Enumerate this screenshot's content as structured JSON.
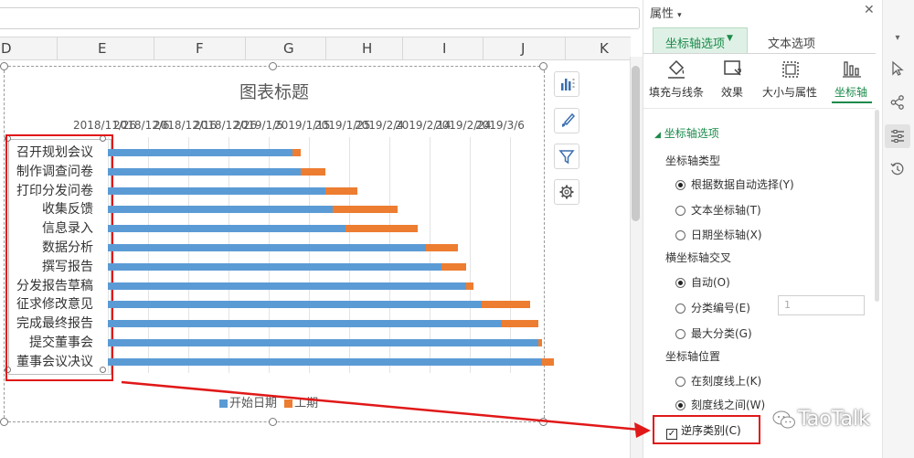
{
  "spreadsheet": {
    "columns": [
      "D",
      "E",
      "F",
      "G",
      "H",
      "I",
      "J",
      "K"
    ]
  },
  "chart": {
    "title": "图表标题",
    "legend": [
      "开始日期",
      "工期"
    ]
  },
  "chart_data": {
    "type": "bar",
    "orientation": "horizontal-stacked",
    "title": "图表标题",
    "x_tick_labels": [
      "2018/11/26",
      "2018/12/6",
      "2018/12/16",
      "2018/12/26",
      "2019/1/5",
      "2019/1/15",
      "2019/1/25",
      "2019/2/4",
      "2019/2/14",
      "2019/2/24",
      "2019/3/6"
    ],
    "categories": [
      "召开规划会议",
      "制作调查问卷",
      "打印分发问卷",
      "收集反馈",
      "信息录入",
      "数据分析",
      "撰写报告",
      "分发报告草稿",
      "征求修改意见",
      "完成最终报告",
      "提交董事会",
      "董事会议决议"
    ],
    "x_axis_start": "2018/11/26",
    "x_axis_end": "2019/3/6",
    "series": [
      {
        "name": "开始日期",
        "color": "#5b9bd5",
        "values": [
          "2019/1/11",
          "2019/1/13",
          "2019/1/19",
          "2019/1/21",
          "2019/1/24",
          "2019/2/13",
          "2019/2/17",
          "2019/2/23",
          "2019/2/27",
          "2019/3/4",
          "2019/3/13",
          "2019/3/14"
        ]
      },
      {
        "name": "工期",
        "color": "#ed7d31",
        "unit": "days",
        "values": [
          2,
          6,
          8,
          16,
          18,
          8,
          6,
          2,
          12,
          9,
          1,
          3
        ]
      }
    ],
    "legend_position": "bottom",
    "grid": true
  },
  "panel": {
    "header": "属性",
    "tabs": [
      "坐标轴选项",
      "文本选项"
    ],
    "subtabs": [
      {
        "label": "填充与线条",
        "icon": "fill-bucket-icon"
      },
      {
        "label": "效果",
        "icon": "effects-icon"
      },
      {
        "label": "大小与属性",
        "icon": "size-properties-icon"
      },
      {
        "label": "坐标轴",
        "icon": "axis-bars-icon"
      }
    ],
    "section_title": "坐标轴选项",
    "axis_type": {
      "label": "坐标轴类型",
      "options": [
        "根据数据自动选择(Y)",
        "文本坐标轴(T)",
        "日期坐标轴(X)"
      ],
      "selected": 0
    },
    "cross": {
      "label": "横坐标轴交叉",
      "options": [
        "自动(O)",
        "分类编号(E)",
        "最大分类(G)"
      ],
      "selected": 0,
      "value": "1"
    },
    "position": {
      "label": "坐标轴位置",
      "options": [
        "在刻度线上(K)",
        "刻度线之间(W)"
      ],
      "selected": 1
    },
    "reverse": {
      "label": "逆序类别(C)",
      "checked": true
    }
  },
  "rail_icons": [
    "dropdown-caret-icon",
    "cursor-icon",
    "share-icon",
    "settings-sliders-icon",
    "history-icon"
  ],
  "watermark": "TaoTalk",
  "colors": {
    "accent": "#1a8a4a",
    "highlight": "#e11818",
    "bar_start": "#5b9bd5",
    "bar_duration": "#ed7d31"
  }
}
